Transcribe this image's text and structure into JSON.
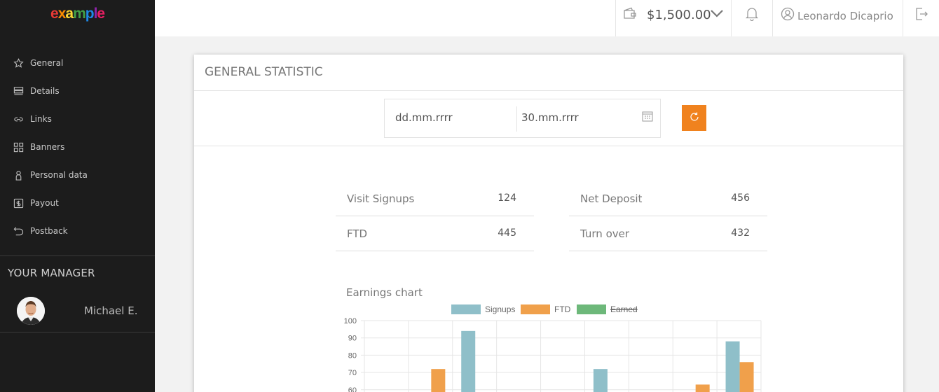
{
  "sidebar": {
    "logo": [
      "e",
      "x",
      "a",
      "m",
      "p",
      "l",
      "e"
    ],
    "items": [
      {
        "label": "General",
        "icon": "star-icon"
      },
      {
        "label": "Details",
        "icon": "list-icon"
      },
      {
        "label": "Links",
        "icon": "link-icon"
      },
      {
        "label": "Banners",
        "icon": "grid-icon"
      },
      {
        "label": "Personal data",
        "icon": "person-icon"
      },
      {
        "label": "Payout",
        "icon": "dollar-icon"
      },
      {
        "label": "Postback",
        "icon": "undo-icon"
      }
    ],
    "manager_title": "YOUR MANAGER",
    "manager_name": "Michael E."
  },
  "topbar": {
    "balance": "$1,500.00",
    "user_name": "Leonardo Dicaprio"
  },
  "card": {
    "title": "GENERAL STATISTIC",
    "date_from": "dd.mm.rrrr",
    "date_to": "30.mm.rrrr",
    "stats": [
      {
        "label": "Visit Signups",
        "value": "124"
      },
      {
        "label": "Net Deposit",
        "value": "456"
      },
      {
        "label": "FTD",
        "value": "445"
      },
      {
        "label": "Turn over",
        "value": "432"
      }
    ],
    "chart_title": "Earnings chart"
  },
  "colors": {
    "accent": "#f0821e",
    "sidebar_bg": "#1c1c1c",
    "signups": "#8fbfc9",
    "ftd": "#f0a04b",
    "earned": "#6db87a"
  },
  "chart_data": {
    "type": "bar",
    "title": "Earnings chart",
    "legend": [
      "Signups",
      "FTD",
      "Earned"
    ],
    "legend_hidden": [
      "Earned"
    ],
    "ylim": [
      0,
      100
    ],
    "yticks": [
      "100",
      "90",
      "80",
      "70",
      "60"
    ],
    "num_categories": 9,
    "series": [
      {
        "name": "Signups",
        "values": [
          null,
          null,
          94,
          null,
          null,
          72,
          null,
          null,
          88
        ]
      },
      {
        "name": "FTD",
        "values": [
          null,
          72,
          null,
          null,
          null,
          null,
          null,
          63,
          76
        ]
      }
    ]
  }
}
